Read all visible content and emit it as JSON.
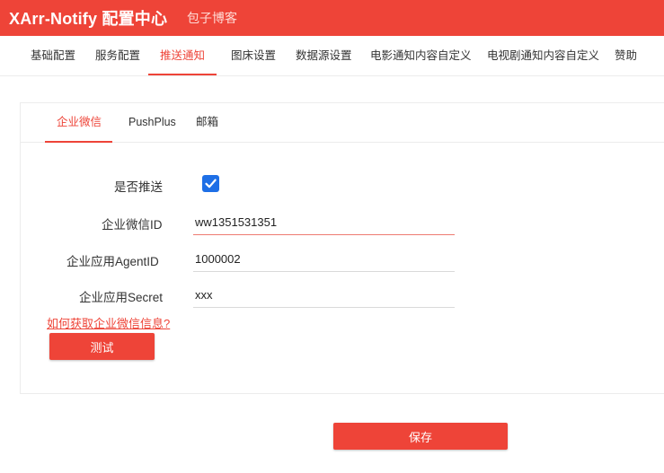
{
  "header": {
    "title": "XArr-Notify 配置中心",
    "subtitle": "包子博客"
  },
  "nav": {
    "tabs": [
      "基础配置",
      "服务配置",
      "推送通知",
      "图床设置",
      "数据源设置",
      "电影通知内容自定义",
      "电视剧通知内容自定义",
      "赞助"
    ],
    "active_index": 2
  },
  "subtabs": {
    "tabs": [
      "企业微信",
      "PushPlus",
      "邮箱"
    ],
    "active_index": 0
  },
  "form": {
    "push_label": "是否推送",
    "push_checked": true,
    "corp_id_label": "企业微信ID",
    "corp_id_value": "ww1351531351",
    "agent_id_label": "企业应用AgentID",
    "agent_id_value": "1000002",
    "secret_label": "企业应用Secret",
    "secret_value": "xxx",
    "help_link": "如何获取企业微信信息?",
    "test_button": "测试"
  },
  "save_button": "保存",
  "colors": {
    "accent": "#ee4438",
    "checkbox": "#1e6fe6"
  }
}
